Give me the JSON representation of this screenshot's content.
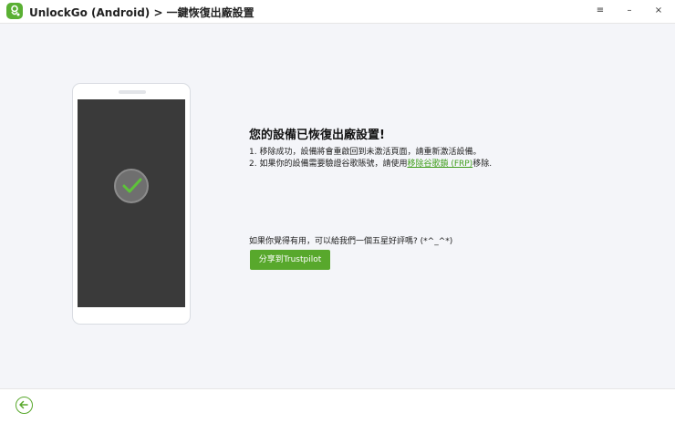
{
  "app": {
    "title": "UnlockGo (Android) > 一鍵恢復出廠設置",
    "brand_color": "#5ab033",
    "logo_icon": "unlockgo-logo-icon"
  },
  "window_controls": {
    "menu": "≡",
    "minimize": "–",
    "close": "×"
  },
  "result": {
    "headline": "您的設備已恢復出廠設置!",
    "step1": "1. 移除成功，設備將會重啟回到未激活頁面，請重新激活設備。",
    "step2_prefix": "2. 如果你的設備需要驗證谷歌賬號，請使用",
    "step2_link": "移除谷歌鎖 (FRP)",
    "step2_suffix": "移除.",
    "status_icon": "checkmark-icon"
  },
  "share": {
    "prompt": "如果你覺得有用，可以給我們一個五星好評嗎? (*^_^*)",
    "button_label": "分享到Trustpilot"
  },
  "footer": {
    "back_icon": "back-arrow-icon"
  }
}
